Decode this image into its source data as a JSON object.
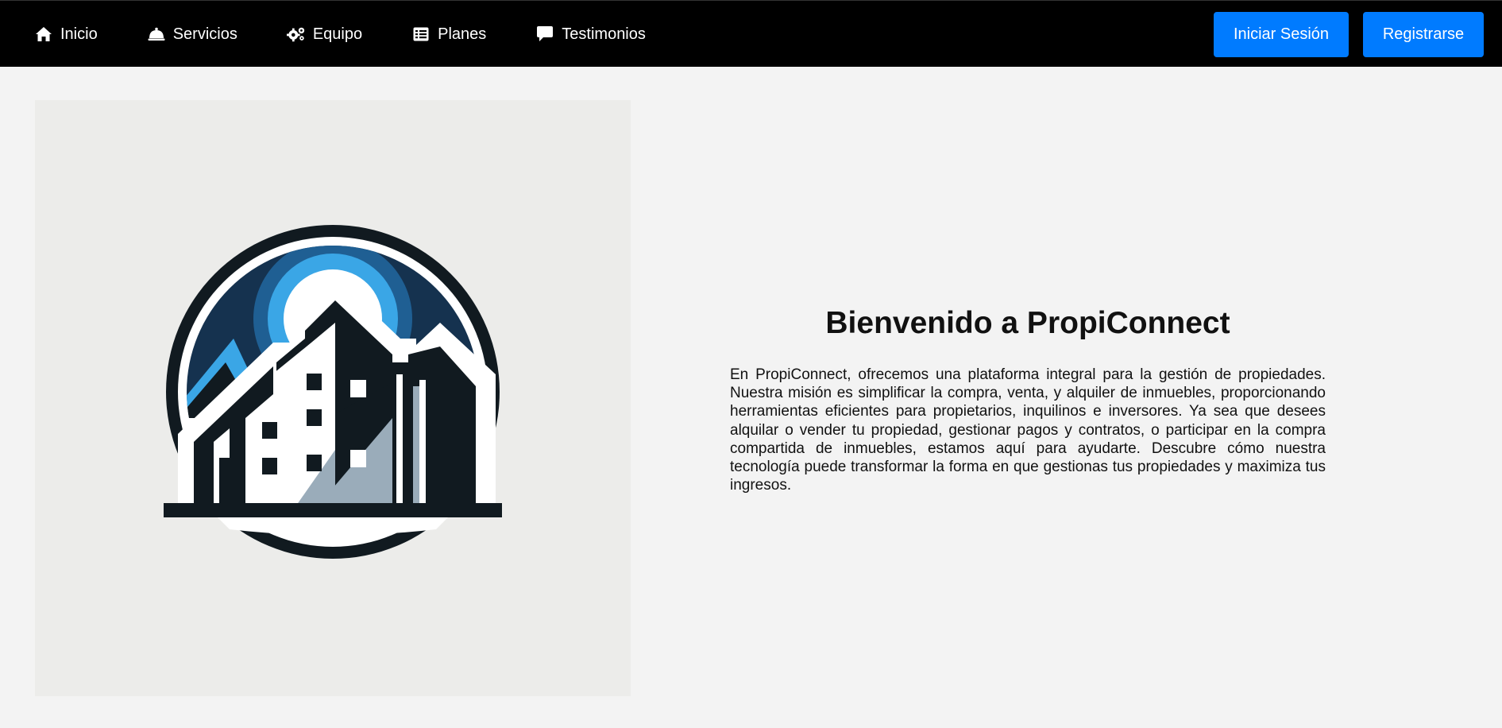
{
  "navbar": {
    "links": [
      {
        "label": "Inicio",
        "icon": "home-icon"
      },
      {
        "label": "Servicios",
        "icon": "bell-icon"
      },
      {
        "label": "Equipo",
        "icon": "gears-icon"
      },
      {
        "label": "Planes",
        "icon": "list-icon"
      },
      {
        "label": "Testimonios",
        "icon": "comment-icon"
      }
    ],
    "login_label": "Iniciar Sesión",
    "register_label": "Registrarse"
  },
  "hero": {
    "title": "Bienvenido a PropiConnect",
    "description": "En PropiConnect, ofrecemos una plataforma integral para la gestión de propiedades. Nuestra misión es simplificar la compra, venta, y alquiler de inmuebles, proporcionando herramientas eficientes para propietarios, inquilinos e inversores. Ya sea que desees alquilar o vender tu propiedad, gestionar pagos y contratos, o participar en la compra compartida de inmuebles, estamos aquí para ayudarte. Descubre cómo nuestra tecnología puede transformar la forma en que gestionas tus propiedades y maximiza tus ingresos."
  },
  "colors": {
    "accent": "#007bff",
    "navbar_bg": "#000000",
    "page_bg": "#f3f3f3",
    "logo_navy": "#15324f",
    "logo_blue": "#3aa6e6",
    "logo_dark": "#111a20"
  }
}
